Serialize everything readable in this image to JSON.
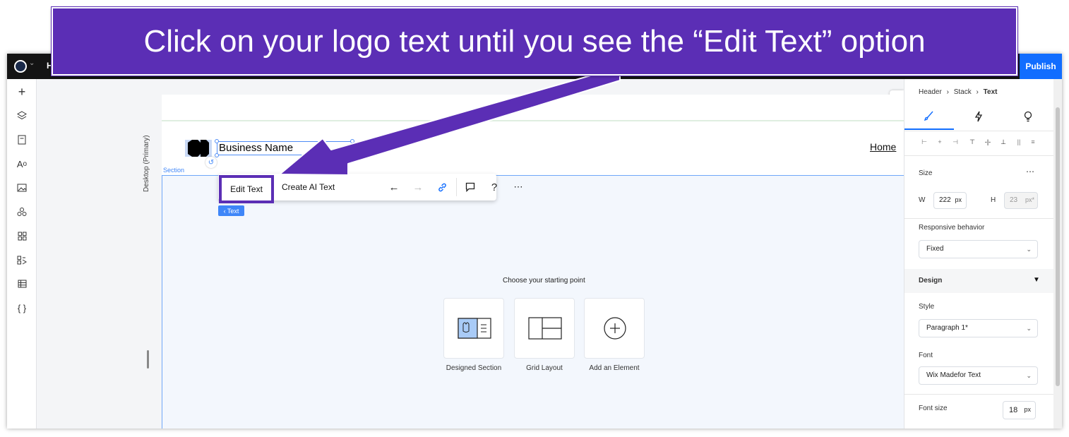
{
  "annotation": {
    "instruction": "Click on your logo text until you see the “Edit Text” option"
  },
  "topbar": {
    "logo_icon": "wix-logo-icon",
    "truncated_label": "H",
    "publish_label": "Publish"
  },
  "leftbar": {
    "icons": [
      "add-icon",
      "layers-icon",
      "pages-icon",
      "typography-icon",
      "media-icon",
      "apps-icon",
      "grid-apps-icon",
      "business-apps-icon",
      "cms-table-icon",
      "code-icon"
    ]
  },
  "canvas": {
    "viewport_label": "Desktop (Primary)",
    "section_label": "Section",
    "business_name": "Business Name",
    "nav_home": "Home",
    "text_tag": "‹ Text",
    "toolbar": {
      "edit_text": "Edit Text",
      "create_ai_text": "Create AI Text"
    },
    "chooser": {
      "title": "Choose your starting point",
      "options": [
        "Designed Section",
        "Grid Layout",
        "Add an Element"
      ]
    }
  },
  "inspector": {
    "breadcrumb": [
      "Header",
      "Stack",
      "Text"
    ],
    "size_label": "Size",
    "width_label": "W",
    "width_value": "222",
    "width_unit": "px",
    "height_label": "H",
    "height_value": "23",
    "height_unit": "px*",
    "responsive_label": "Responsive behavior",
    "responsive_value": "Fixed",
    "design_label": "Design",
    "style_label": "Style",
    "style_value": "Paragraph 1*",
    "font_label": "Font",
    "font_value": "Wix Madefor Text",
    "font_size_label": "Font size",
    "font_size_value": "18",
    "font_size_unit": "px"
  },
  "colors": {
    "annotation_purple": "#5b2eb5",
    "wix_blue": "#116dff",
    "selection_blue": "#3f86f8"
  }
}
